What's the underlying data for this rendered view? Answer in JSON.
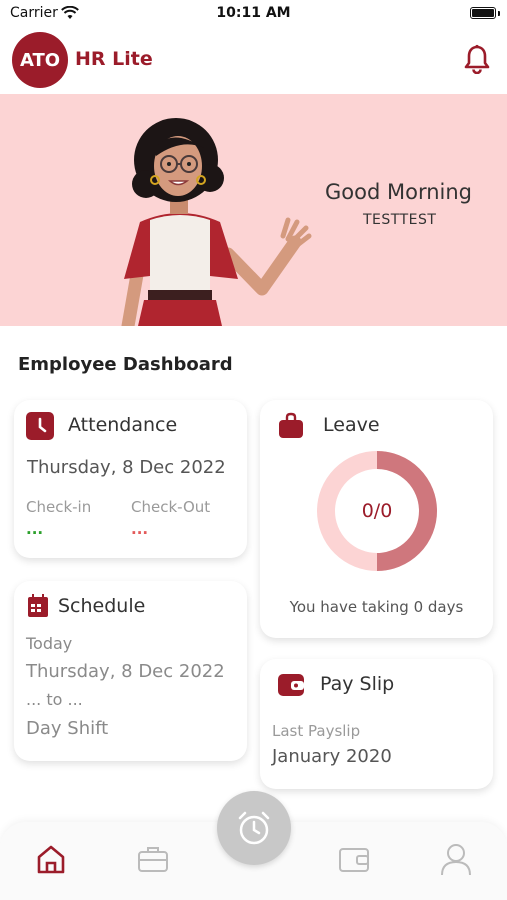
{
  "status_bar": {
    "carrier": "Carrier",
    "time": "10:11 AM"
  },
  "header": {
    "logo_text": "ATO",
    "app_name": "HR Lite",
    "brand_color": "#9b1c2a"
  },
  "banner": {
    "greeting": "Good Morning",
    "username": "TESTTEST",
    "background": "#fcd4d4"
  },
  "dashboard": {
    "title": "Employee Dashboard"
  },
  "attendance": {
    "title": "Attendance",
    "date": "Thursday, 8 Dec 2022",
    "checkin_label": "Check-in",
    "checkin_value": "...",
    "checkout_label": "Check-Out",
    "checkout_value": "..."
  },
  "schedule": {
    "title": "Schedule",
    "today_label": "Today",
    "date": "Thursday, 8 Dec 2022",
    "range": "... to ...",
    "shift": "Day Shift"
  },
  "leave": {
    "title": "Leave",
    "ratio": "0/0",
    "summary": "You have taking 0 days",
    "used_fraction": 0.5
  },
  "payslip": {
    "title": "Pay Slip",
    "label": "Last Payslip",
    "value": "January 2020"
  },
  "bottom_nav": {
    "items": [
      "home-icon",
      "briefcase-icon",
      "clock-icon",
      "wallet-icon",
      "user-icon"
    ],
    "active": "home-icon"
  }
}
